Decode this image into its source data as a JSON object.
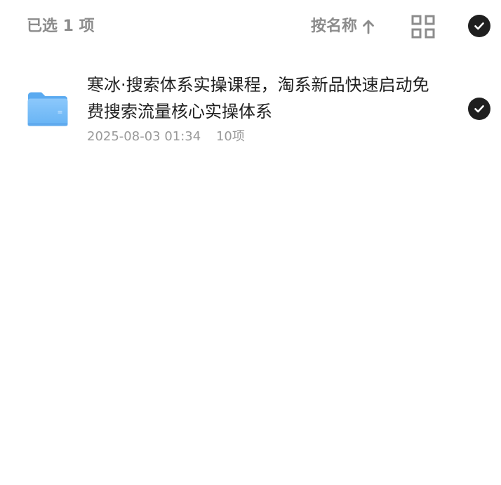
{
  "header": {
    "selected_count_label": "已选 1 项",
    "sort_label": "按名称",
    "sort_direction_icon": "arrow-up-icon",
    "view_toggle_icon": "grid-view-icon",
    "select_all_icon": "check-circle-icon",
    "select_all_checked": true
  },
  "colors": {
    "primary_text": "#1f1f1f",
    "secondary_text": "#8c8c8c",
    "meta_text": "#999999",
    "check_fill": "#1f1f1f",
    "folder_blue": "#5aaaf0",
    "background": "#ffffff"
  },
  "files": [
    {
      "name": "寒冰·搜索体系实操课程，淘系新品快速启动免费搜索流量核心实操体系",
      "date": "2025-08-03 01:34",
      "item_count": "10项",
      "icon": "folder-icon",
      "checked": true
    }
  ]
}
